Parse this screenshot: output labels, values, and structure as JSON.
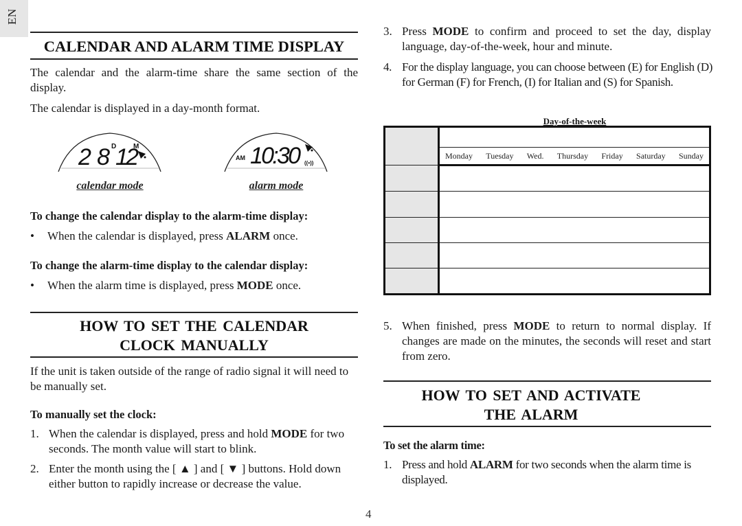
{
  "language_tab": "EN",
  "page_number": "4",
  "left": {
    "section1": {
      "title": "CALENDAR AND ALARM TIME DISPLAY",
      "para1": "The calendar and the alarm-time share the same section of the display.",
      "para2": "The calendar is displayed in a day-month format.",
      "calendar_lcd": {
        "day": "28",
        "day_unit": "D",
        "month": "12",
        "month_unit": "M",
        "icon": "bell-icon"
      },
      "alarm_lcd": {
        "period": "AM",
        "time": "10:30",
        "icons": [
          "bell-icon",
          "alarm-wave-icon"
        ],
        "wave_text": "((•))"
      },
      "caption_calendar": "calendar mode",
      "caption_alarm": "alarm mode",
      "sub1": "To change the calendar display to the alarm-time display:",
      "bullet1": {
        "pre": "When the calendar is displayed, press ",
        "bold": "ALARM",
        "post": " once."
      },
      "sub2": "To change the alarm-time display to the calendar display:",
      "bullet2": {
        "pre": "When the alarm time is displayed, press ",
        "bold": "MODE",
        "post": " once."
      },
      "bullet_glyph": "•"
    },
    "section2": {
      "title_line1": "HOW TO SET THE CALENDAR",
      "title_line2": "CLOCK MANUALLY",
      "para": "If the unit is taken outside of the range of radio signal it will need to be manually set.",
      "sub": "To manually set the clock:",
      "steps": [
        {
          "num": "1.",
          "pre": "When the calendar is displayed, press and hold ",
          "bold": "MODE",
          "post": " for two seconds. The month value will start to blink."
        },
        {
          "num": "2.",
          "pre": "Enter the month using the [ ",
          "up": "▲",
          "mid": " ] and [ ",
          "down": "▼",
          "post": " ]  buttons. Hold down either button to rapidly increase or decrease the value."
        }
      ]
    }
  },
  "right": {
    "steps": [
      {
        "num": "3.",
        "pre": "Press ",
        "bold": "MODE",
        "post": " to confirm and proceed to set the day, display language, day-of-the-week, hour and minute."
      },
      {
        "num": "4.",
        "text": "For the display language, you can choose between (E) for English (D) for German (F) for French, (I) for Italian and (S) for Spanish."
      }
    ],
    "table": {
      "title": "Day-of-the-week",
      "days": [
        "Monday",
        "Tuesday",
        "Wed.",
        "Thursday",
        "Friday",
        "Saturday",
        "Sunday"
      ],
      "language_rows": [
        "",
        "",
        "",
        "",
        ""
      ]
    },
    "step5": {
      "num": "5.",
      "pre": "When finished, press ",
      "bold": "MODE",
      "post": " to return to normal display.  If changes are made on the minutes, the seconds will reset and start from zero."
    },
    "section3": {
      "title_line1": "HOW TO SET AND ACTIVATE",
      "title_line2": "THE ALARM",
      "sub": "To set the alarm time:",
      "steps": [
        {
          "num": "1.",
          "pre": "Press and hold ",
          "bold": "ALARM",
          "post": " for two seconds when the alarm time is displayed."
        }
      ]
    }
  }
}
